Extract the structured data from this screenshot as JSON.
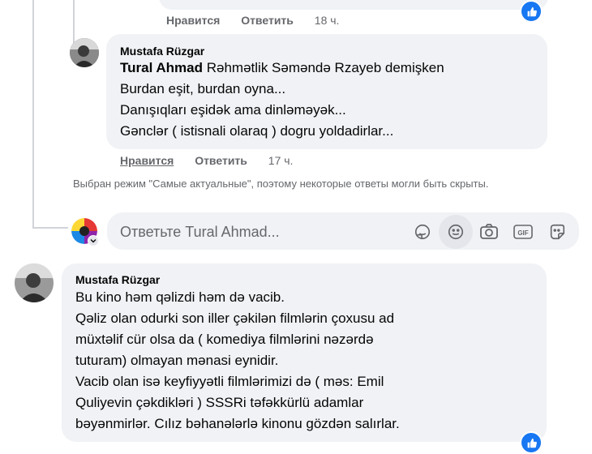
{
  "top_comment": {
    "like_label": "Нравится",
    "reply_label": "Ответить",
    "time": "18 ч."
  },
  "reply_comment": {
    "author": "Mustafa Rüzgar",
    "mention": "Tural Ahmad",
    "first_line_rest": " Rəhmətlik Səməndə Rzayeb demişken",
    "lines": [
      "Burdan eşit, burdan oyna...",
      "Danışıqları eşidək ama dinləməyək...",
      "Gənclər ( istisnali olaraq ) dogru yoldadirlar..."
    ],
    "like_label": "Нравится",
    "reply_label": "Ответить",
    "time": "17 ч."
  },
  "notice": "Выбран режим \"Самые актуальные\", поэтому некоторые ответы могли быть скрыты.",
  "reply_box": {
    "placeholder": "Ответьте Tural Ahmad...",
    "tools": [
      "sticker-icon",
      "emoji-icon",
      "camera-icon",
      "gif-icon",
      "avatar-sticker-icon"
    ]
  },
  "main_comment": {
    "author": "Mustafa Rüzgar",
    "lines": [
      "Bu kino həm qəlizdi həm də vacib.",
      "Qəliz olan odurki son iller çəkilən filmlərin çoxusu ad",
      "müxtəlif cür olsa da ( komediya filmlərini nəzərdə",
      "tuturam) olmayan mənasi eynidir.",
      "Vacib olan isə keyfiyyətli filmlərimizi də ( məs: Emil",
      "Quliyevin çəkdikləri ) SSSRi təfəkkürlü adamlar",
      "bəyənmirlər. Cılız bəhanələrlə kinonu gözdən salırlar."
    ]
  },
  "colors": {
    "bubble": "#f0f2f5",
    "meta": "#65676b",
    "like_blue": "#1877f2"
  }
}
